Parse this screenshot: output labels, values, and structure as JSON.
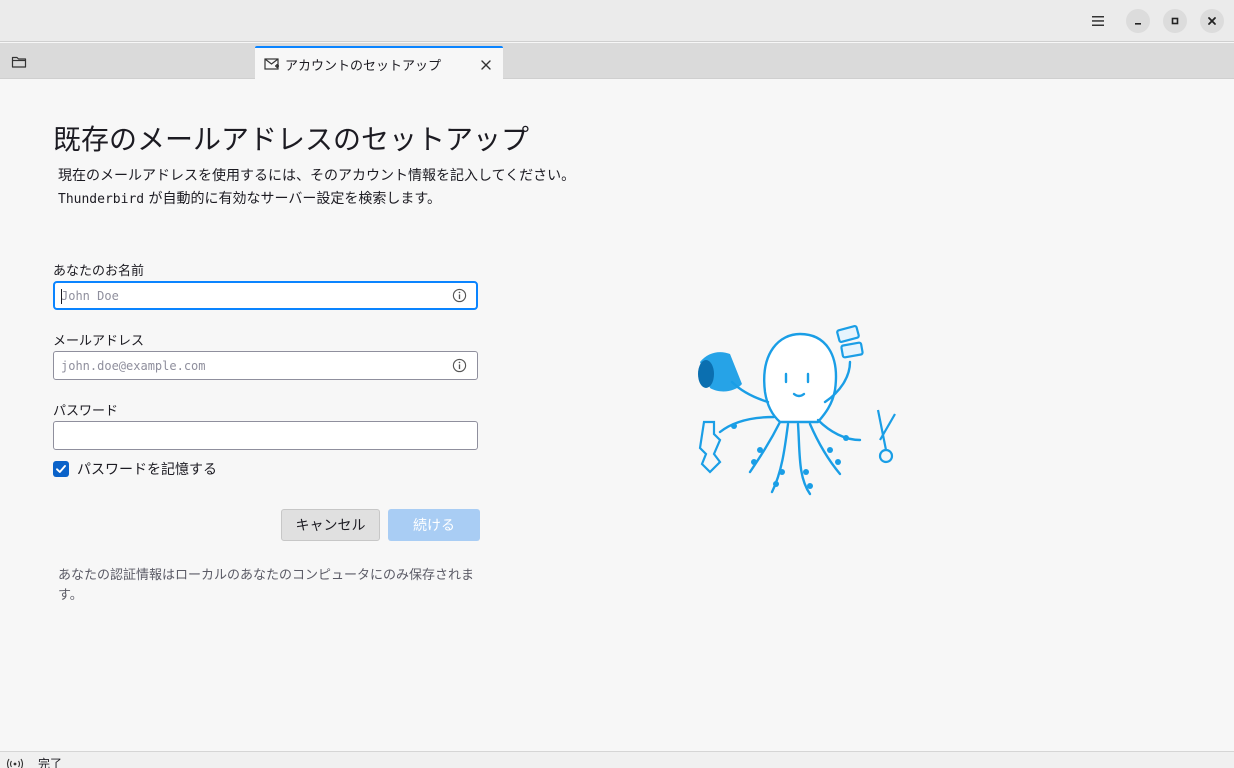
{
  "window": {
    "menu_icon": "hamburger-menu-icon",
    "minimize_icon": "minimize-icon",
    "maximize_icon": "maximize-icon",
    "close_icon": "close-icon"
  },
  "tabs": {
    "folder_icon": "folder-icon",
    "active_tab": {
      "title": "アカウントのセットアップ",
      "icon": "mail-new-icon",
      "close_icon": "close-icon"
    }
  },
  "setup": {
    "heading": "既存のメールアドレスのセットアップ",
    "intro_line1": "現在のメールアドレスを使用するには、そのアカウント情報を記入してください。",
    "intro_app": "Thunderbird",
    "intro_line2_rest": " が自動的に有効なサーバー設定を検索します。",
    "name": {
      "label": "あなたのお名前",
      "placeholder": "John Doe",
      "value": ""
    },
    "email": {
      "label": "メールアドレス",
      "placeholder": "john.doe@example.com",
      "value": ""
    },
    "password": {
      "label": "パスワード",
      "value": ""
    },
    "remember": {
      "label": "パスワードを記憶する",
      "checked": true
    },
    "cancel_label": "キャンセル",
    "continue_label": "続ける",
    "privacy_note": "あなたの認証情報はローカルのあなたのコンピュータにのみ保存されます。"
  },
  "colors": {
    "accent": "#0a84ff",
    "continue_disabled": "#a9cdf4",
    "mascot": "#1a9ee6"
  },
  "status": {
    "icon": "wifi-signal-icon",
    "text": "完了"
  }
}
